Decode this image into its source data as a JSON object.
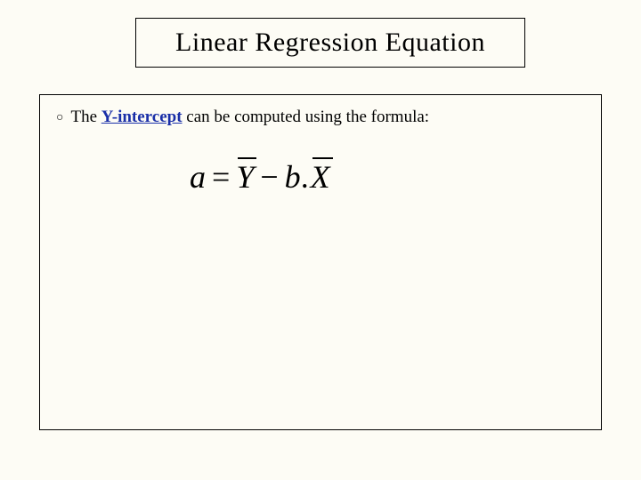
{
  "title": "Linear  Regression Equation",
  "bullet": {
    "marker": "○",
    "prefix": "The ",
    "highlight": "Y-intercept",
    "suffix": " can be computed using the formula:"
  },
  "formula": {
    "a": "a",
    "eq": "=",
    "Ybar": "Y",
    "minus": "−",
    "b": "b",
    "dot": ".",
    "Xbar": "X"
  }
}
